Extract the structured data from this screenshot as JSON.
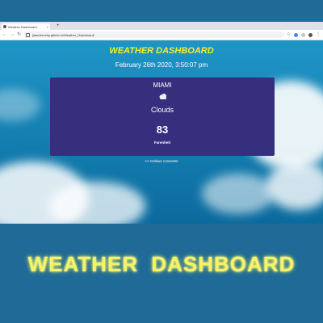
{
  "browser": {
    "tab_title": "Weather Dashboard",
    "new_tab": "+",
    "url": "jiawchenehy.github.io/Weather_Dashboard/"
  },
  "page": {
    "title": "WEATHER DASHBOARD",
    "datetime": "February 26th 2020, 3:50:07 pm",
    "weather": {
      "city": "MIAMI",
      "icon": "clouds-icon",
      "condition": "Clouds",
      "temperature": "83",
      "unit": "Farenheit"
    },
    "converter_link": ">> Celsius converter"
  },
  "banner": {
    "text": "WEATHER DASHBOARD"
  },
  "colors": {
    "background": "#1f6a96",
    "title_yellow": "#f7ee2c",
    "card": "#362f7d"
  }
}
